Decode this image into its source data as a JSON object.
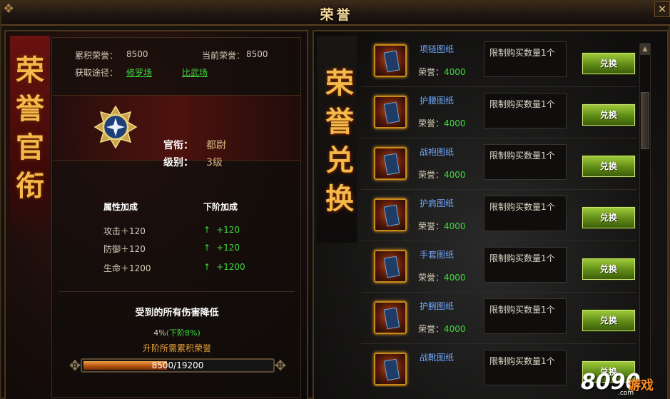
{
  "window": {
    "title": "荣誉",
    "close_label": "✕"
  },
  "left": {
    "banner": "荣誉官衔",
    "total_honor_label": "累积荣誉：",
    "total_honor_value": "8500",
    "current_honor_label": "当前荣誉：",
    "current_honor_value": "8500",
    "source_label": "获取途径：",
    "source_links": [
      "修罗场",
      "比武场"
    ],
    "rank_title_label": "官衔：",
    "rank_title_value": "都尉",
    "rank_level_label": "级别：",
    "rank_level_value": "3级",
    "attr_header": "属性加成",
    "next_header": "下阶加成",
    "attributes": [
      {
        "name": "攻击＋120",
        "next": "+120"
      },
      {
        "name": "防御＋120",
        "next": "+120"
      },
      {
        "name": "生命＋1200",
        "next": "+1200"
      }
    ],
    "damage_title": "受到的所有伤害降低",
    "damage_value": "4%",
    "damage_next": "(下阶8%)",
    "upgrade_tip": "升阶所需累积荣誉",
    "progress_text": "8500/19200",
    "progress_fraction": 0.4427
  },
  "right": {
    "banner": "荣誉兑换",
    "cost_label": "荣誉：",
    "limit_text": "限制购买数量1个",
    "button_label": "兑换",
    "items": [
      {
        "name": "项链图纸",
        "cost": "4000"
      },
      {
        "name": "护腰图纸",
        "cost": "4000"
      },
      {
        "name": "战袍图纸",
        "cost": "4000"
      },
      {
        "name": "护肩图纸",
        "cost": "4000"
      },
      {
        "name": "手套图纸",
        "cost": "4000"
      },
      {
        "name": "护腕图纸",
        "cost": "4000"
      },
      {
        "name": "战靴图纸",
        "cost": ""
      }
    ]
  },
  "watermark": {
    "number": "8090",
    "game": "游戏",
    "site": ".com"
  },
  "colors": {
    "accent": "#f2d79a",
    "green": "#3fdb3f",
    "link_blue": "#6ea8ff",
    "orange": "#e8a33a"
  }
}
